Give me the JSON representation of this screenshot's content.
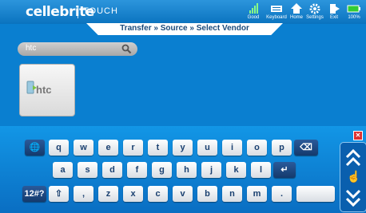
{
  "header": {
    "logo": "cellebrite",
    "logo_sub": "TOUCH",
    "items": [
      {
        "label": "Good",
        "icon": "signal-icon"
      },
      {
        "label": "Keyboard",
        "icon": "keyboard-icon"
      },
      {
        "label": "Home",
        "icon": "home-icon"
      },
      {
        "label": "Settings",
        "icon": "settings-icon"
      },
      {
        "label": "Exit",
        "icon": "exit-icon"
      },
      {
        "label": "100%",
        "icon": "battery-icon"
      }
    ]
  },
  "breadcrumb": "Transfer » Source » Select Vendor",
  "search": {
    "value": "htc",
    "icon": "search-icon"
  },
  "vendors": [
    {
      "label": "htc"
    }
  ],
  "keyboard": {
    "row1": [
      "q",
      "w",
      "e",
      "r",
      "t",
      "y",
      "u",
      "i",
      "o",
      "p"
    ],
    "row2": [
      "a",
      "s",
      "d",
      "f",
      "g",
      "h",
      "j",
      "k",
      "l"
    ],
    "row3": [
      ",",
      "z",
      "x",
      "c",
      "v",
      "b",
      "n",
      "m",
      "."
    ],
    "mode_key": "12#?",
    "close_icon": "close-icon",
    "colors": {
      "panel": "#0a7fd0",
      "key": "#ffffff",
      "dark_key": "#1e4d8a"
    }
  }
}
